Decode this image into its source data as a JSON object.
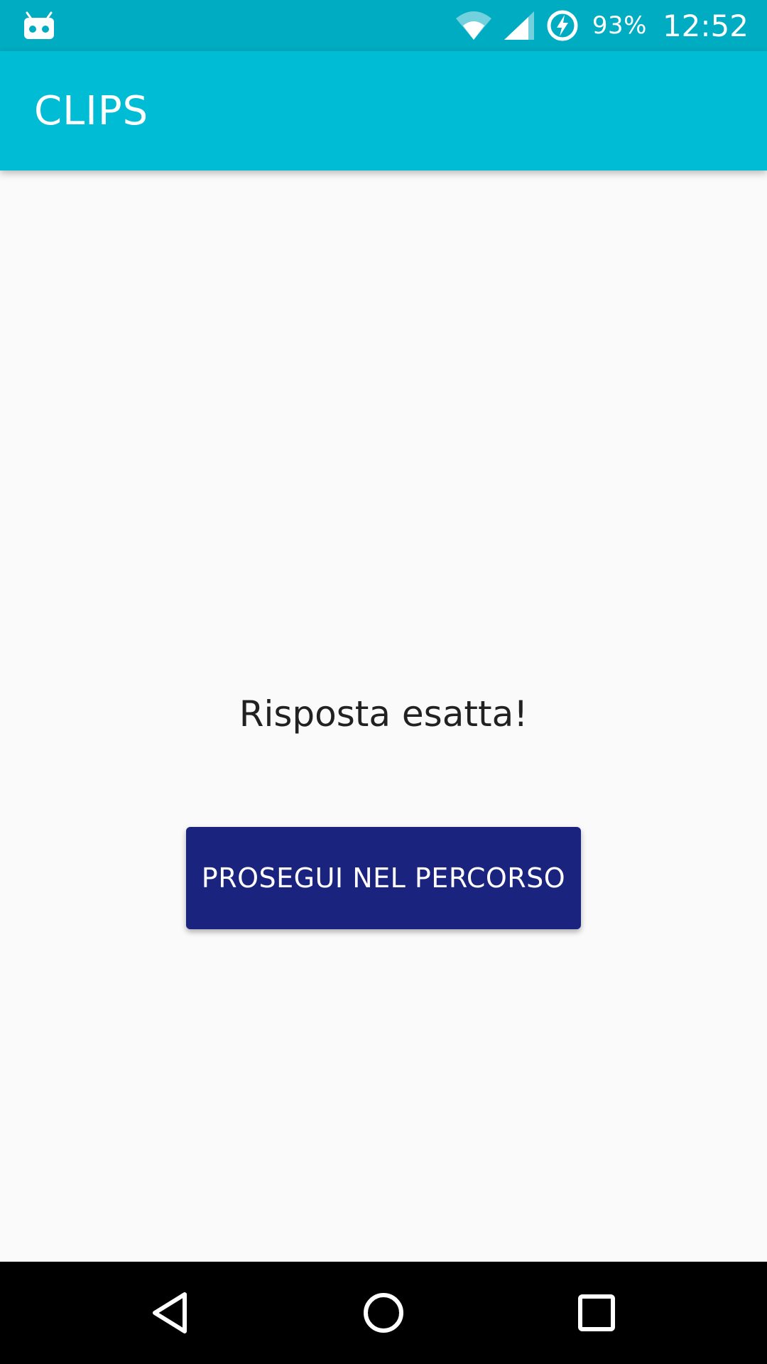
{
  "status_bar": {
    "battery_percent": "93%",
    "time": "12:52",
    "icons": [
      "android-debug-icon",
      "wifi-icon",
      "cell-signal-icon",
      "battery-charging-icon"
    ],
    "background_color": "#00acc1"
  },
  "app_bar": {
    "title": "CLIPS",
    "background_color": "#00bcd4"
  },
  "main": {
    "message": "Risposta esatta!",
    "continue_button_label": "PROSEGUI NEL PERCORSO",
    "button_color": "#1a237e"
  },
  "nav_bar": {
    "icons": [
      "back-icon",
      "home-icon",
      "recents-icon"
    ]
  }
}
